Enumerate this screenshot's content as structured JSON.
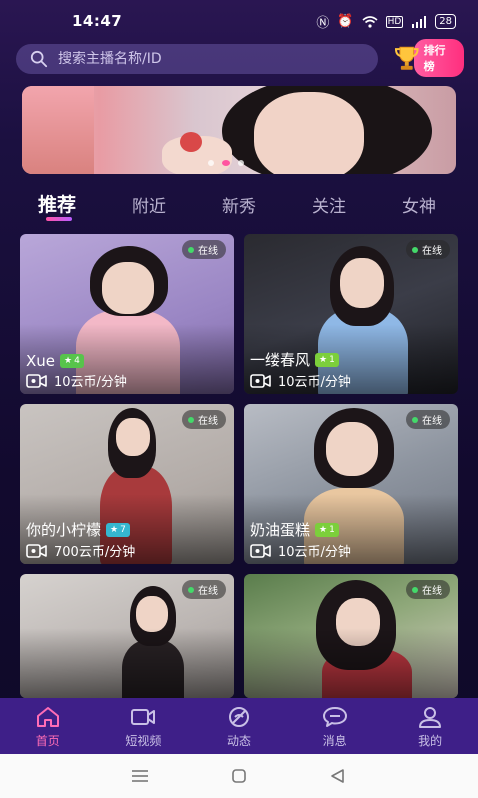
{
  "status_bar": {
    "time": "14:47",
    "battery": "28",
    "icons": [
      "nfc-icon",
      "alarm-icon",
      "wifi-icon",
      "hd-icon",
      "signal-icon",
      "battery-icon"
    ]
  },
  "search": {
    "placeholder": "搜索主播名称/ID"
  },
  "rank": {
    "label": "排行榜"
  },
  "banner": {
    "dots": 3,
    "active_dot": 1
  },
  "tabs": [
    {
      "label": "推荐",
      "active": true
    },
    {
      "label": "附近",
      "active": false
    },
    {
      "label": "新秀",
      "active": false
    },
    {
      "label": "关注",
      "active": false
    },
    {
      "label": "女神",
      "active": false
    }
  ],
  "cards": [
    {
      "name": "Xue",
      "level": "4",
      "level_color": "#57c44b",
      "price": "10云币/分钟",
      "online": "在线",
      "show_info": true
    },
    {
      "name": "一缕春风",
      "level": "1",
      "level_color": "#7ccf3b",
      "price": "10云币/分钟",
      "online": "在线",
      "show_info": true
    },
    {
      "name": "你的小柠檬",
      "level": "7",
      "level_color": "#35b7cf",
      "price": "700云币/分钟",
      "online": "在线",
      "show_info": true
    },
    {
      "name": "奶油蛋糕",
      "level": "1",
      "level_color": "#7ccf3b",
      "price": "10云币/分钟",
      "online": "在线",
      "show_info": true
    },
    {
      "name": "",
      "level": "",
      "level_color": "#57c44b",
      "price": "",
      "online": "在线",
      "show_info": false
    },
    {
      "name": "",
      "level": "",
      "level_color": "#57c44b",
      "price": "",
      "online": "在线",
      "show_info": false
    }
  ],
  "bottom_nav": [
    {
      "label": "首页",
      "icon": "home-icon",
      "active": true
    },
    {
      "label": "短视频",
      "icon": "video-icon",
      "active": false
    },
    {
      "label": "动态",
      "icon": "moments-icon",
      "active": false
    },
    {
      "label": "消息",
      "icon": "message-icon",
      "active": false
    },
    {
      "label": "我的",
      "icon": "profile-icon",
      "active": false
    }
  ],
  "colors": {
    "accent": "#ff54a6",
    "nav_bg": "#3e1f88",
    "page_bg": "#120a2e"
  }
}
